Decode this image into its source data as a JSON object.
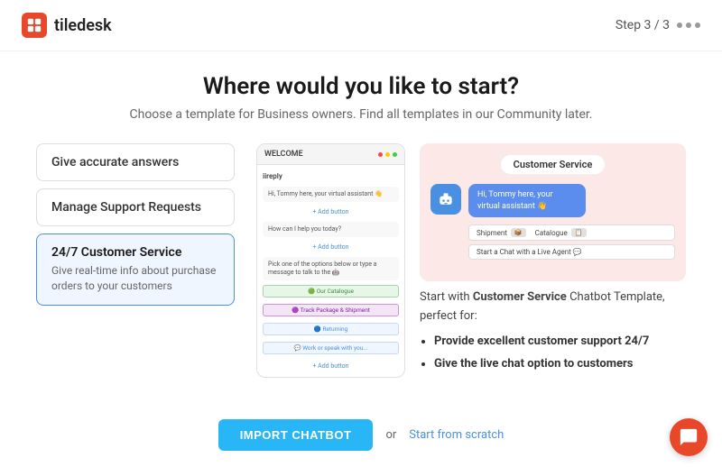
{
  "header": {
    "logo_text": "tiledesk",
    "step_text": "Step  3 / 3",
    "dots": [
      "dot1",
      "dot2",
      "dot3"
    ]
  },
  "page": {
    "title": "Where would you like to start?",
    "subtitle": "Choose a template for Business owners. Find all templates in our Community later."
  },
  "templates": [
    {
      "id": "accurate",
      "label": "Give accurate answers",
      "active": false
    },
    {
      "id": "support",
      "label": "Manage Support Requests",
      "active": false
    },
    {
      "id": "customer",
      "label": "24/7 Customer Service",
      "desc": "Give real-time info about purchase orders to your customers",
      "active": true
    }
  ],
  "flow_preview": {
    "title": "WELCOME",
    "bot_name": "iireply",
    "messages": [
      "Hi, Tommy here, your virtual assistant 👋",
      "How can I help you today?",
      "Pick one of the options below or type a message to talk to the 🤖"
    ],
    "options": [
      "🟢 Our Catalogue",
      "🟣 Track Package & Shipment",
      "🔵 Returning",
      "💬 Work or speak with you..."
    ],
    "add_button": "+ Add button"
  },
  "cs_preview": {
    "header": "Customer Service",
    "bubble": "Hi, Tommy here, your virtual assistant 👋",
    "buttons": [
      {
        "label": "Shipment",
        "badge": "📦"
      },
      {
        "label": "Catalogue",
        "badge": "📋"
      }
    ],
    "live_button": "Start a Chat with a Live Agent 💬"
  },
  "description": {
    "text_prefix": "Start with ",
    "template_name": "Customer Service",
    "text_suffix": " Chatbot Template, perfect for:",
    "bullets": [
      "Provide excellent customer support 24/7",
      "Give the live chat option to customers"
    ]
  },
  "footer": {
    "import_label": "IMPORT CHATBOT",
    "or_text": "or",
    "scratch_link": "Start from scratch"
  }
}
